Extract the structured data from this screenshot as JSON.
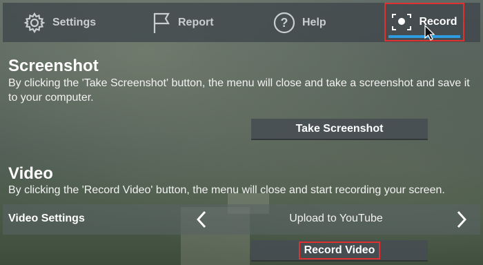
{
  "tabs": {
    "settings": {
      "label": "Settings",
      "icon": "gear-icon"
    },
    "report": {
      "label": "Report",
      "icon": "flag-icon"
    },
    "help": {
      "label": "Help",
      "icon": "question-circle-icon"
    },
    "record": {
      "label": "Record",
      "icon": "record-icon",
      "selected": true
    }
  },
  "screenshot": {
    "title": "Screenshot",
    "description": "By clicking the 'Take Screenshot' button, the menu will close and take a screenshot and save it to your computer.",
    "button_label": "Take Screenshot"
  },
  "video": {
    "title": "Video",
    "description": "By clicking the 'Record Video' button, the menu will close and start recording your screen.",
    "settings_label": "Video Settings",
    "settings_value": "Upload to YouTube",
    "button_label": "Record Video"
  },
  "colors": {
    "accent": "#2f9be0",
    "highlight": "#e03030"
  }
}
